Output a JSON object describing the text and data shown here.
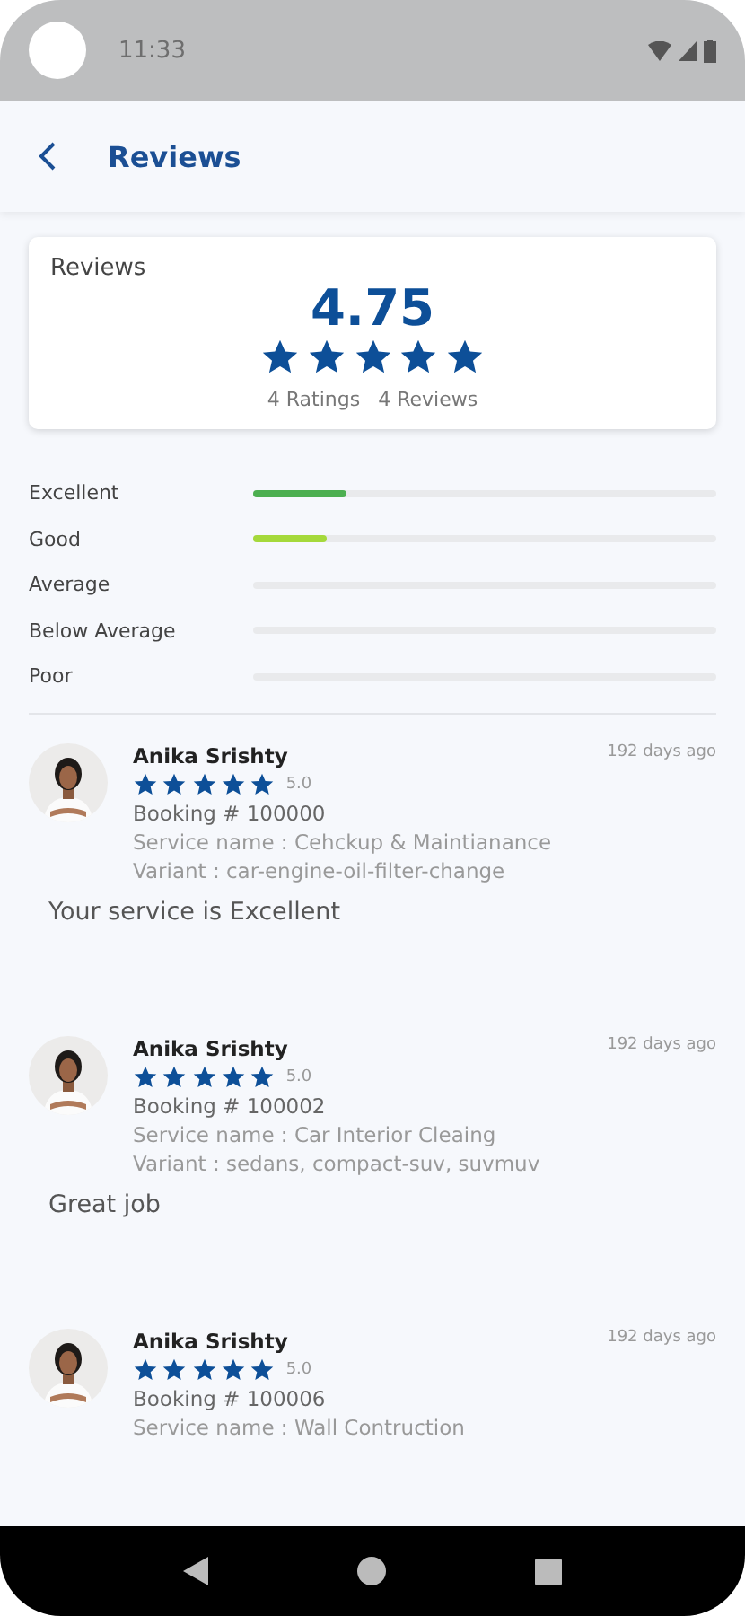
{
  "status_bar": {
    "time": "11:33"
  },
  "header": {
    "title": "Reviews"
  },
  "summary": {
    "title": "Reviews",
    "score": "4.75",
    "stars": 5,
    "ratings": "4 Ratings",
    "reviews": "4 Reviews"
  },
  "rating_bars": [
    {
      "label": "Excellent",
      "level": 0.2,
      "color": "#4caf50"
    },
    {
      "label": "Good",
      "level": 0.16,
      "color": "#a5d93b"
    },
    {
      "label": "Average"
    },
    {
      "label": "Below Average"
    },
    {
      "label": "Poor"
    }
  ],
  "reviews": [
    {
      "name": "Anika Srishty",
      "time": "192 days ago",
      "stars": 5,
      "rating": "5.0",
      "booking": "Booking # 100000",
      "service": "Service name : Cehckup & Maintianance",
      "variant": "Variant : car-engine-oil-filter-change",
      "comment": "Your service is Excellent"
    },
    {
      "name": "Anika Srishty",
      "time": "192 days ago",
      "stars": 5,
      "rating": "5.0",
      "booking": "Booking # 100002",
      "service": "Service name : Car Interior Cleaing",
      "variant": "Variant : sedans, compact-suv, suvmuv",
      "comment": "Great job"
    },
    {
      "name": "Anika Srishty",
      "time": "192 days ago",
      "stars": 5,
      "rating": "5.0",
      "booking": "Booking # 100006",
      "service": "Service name : Wall Contruction"
    }
  ]
}
